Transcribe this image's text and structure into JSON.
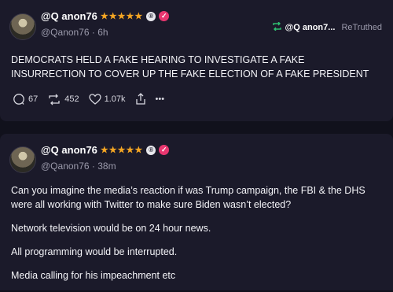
{
  "posts": [
    {
      "display_name": "@Q anon76",
      "stars": "★★★★★",
      "badge": "®",
      "verified": "✓",
      "handle": "@Qanon76",
      "separator": "·",
      "time": "6h",
      "retruth_user": "@Q anon7...",
      "retruth_label": "ReTruthed",
      "text": "DEMOCRATS HELD A FAKE HEARING TO INVESTIGATE A FAKE INSURRECTION TO COVER UP THE FAKE ELECTION OF A FAKE PRESIDENT",
      "replies": "67",
      "retruths": "452",
      "likes": "1.07k",
      "more": "•••"
    },
    {
      "display_name": "@Q anon76",
      "stars": "★★★★★",
      "badge": "®",
      "verified": "✓",
      "handle": "@Qanon76",
      "separator": "·",
      "time": "38m",
      "paragraphs": [
        "Can you imagine the media’s reaction if was Trump campaign, the FBI & the DHS were all working with Twitter to make sure Biden wasn’t elected?",
        "Network television would be on 24 hour news.",
        "All programming would be interrupted.",
        "Media calling for his impeachment etc"
      ]
    }
  ],
  "colors": {
    "background": "#11111c",
    "card": "#1b1a2a",
    "stars": "#f5a623",
    "verified": "#e8366f",
    "retruth": "#2fbf71",
    "muted": "#9b9aab"
  }
}
